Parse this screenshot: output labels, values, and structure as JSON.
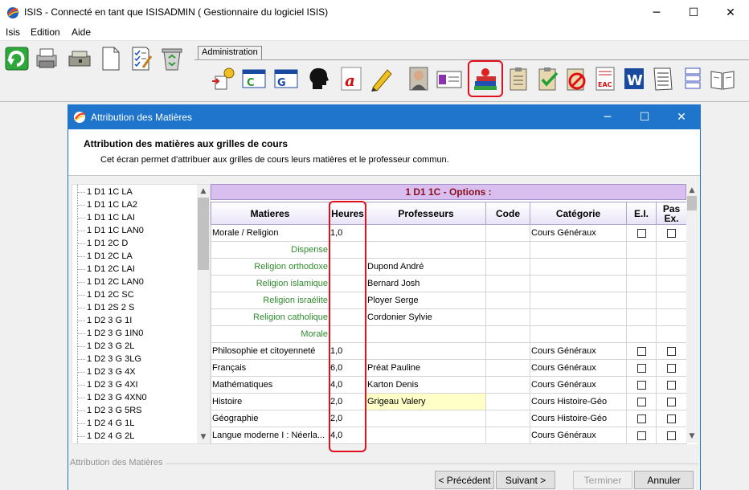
{
  "app": {
    "title": "ISIS - Connecté en tant que ISISADMIN ( Gestionnaire du logiciel ISIS)",
    "window_controls": {
      "minimize": "─",
      "maximize": "☐",
      "close": "✕"
    }
  },
  "menu": {
    "items": [
      "Isis",
      "Edition",
      "Aide"
    ]
  },
  "toolbar": {
    "tab_label": "Administration",
    "left_icons": [
      "refresh-icon",
      "printer-icon",
      "scanner-icon",
      "blank-page-icon",
      "checklist-icon",
      "recycle-bin-icon"
    ],
    "right_icons": [
      "import-settings-icon",
      "window-c-icon",
      "window-g-icon",
      "head-silhouette-icon",
      "letter-a-icon",
      "pencil-icon",
      "photo-person-icon",
      "id-card-icon",
      "books-apple-icon",
      "clipboard-notes-icon",
      "clipboard-check-icon",
      "clipboard-forbidden-icon",
      "eac-document-icon",
      "word-document-icon",
      "checklist-document-icon",
      "layout-rows-icon",
      "open-book-icon"
    ]
  },
  "dialog": {
    "title": "Attribution des Matières",
    "heading": "Attribution des matières aux grilles de cours",
    "description": "Cet écran permet d'attribuer aux grilles de cours leurs matières et le professeur commun.",
    "footer_label": "Attribution des Matières",
    "buttons": {
      "previous": "< Précédent",
      "next": "Suivant >",
      "finish": "Terminer",
      "cancel": "Annuler"
    }
  },
  "tree": {
    "items": [
      "1 D1 1C LA",
      "1 D1 1C LA2",
      "1 D1 1C LAI",
      "1 D1 1C LAN0",
      "1 D1 2C D",
      "1 D1 2C LA",
      "1 D1 2C LAI",
      "1 D1 2C LAN0",
      "1 D1 2C SC",
      "1 D1 2S 2 S",
      "1 D2 3 G 1I",
      "1 D2 3 G 1IN0",
      "1 D2 3 G 2L",
      "1 D2 3 G 3LG",
      "1 D2 3 G 4X",
      "1 D2 3 G 4XI",
      "1 D2 3 G 4XN0",
      "1 D2 3 G 5RS",
      "1 D2 4 G 1L",
      "1 D2 4 G 2L"
    ]
  },
  "grid": {
    "caption": "1 D1 1C  -  Options :",
    "columns": {
      "matieres": "Matieres",
      "heures": "Heures",
      "professeurs": "Professeurs",
      "code": "Code",
      "categorie": "Catégorie",
      "ei": "E.I.",
      "pas_ex": "Pas Ex."
    },
    "rows": [
      {
        "matiere": "Morale / Religion",
        "heures": "1,0",
        "professeur": "",
        "code": "",
        "categorie": "Cours Généraux",
        "checkboxes": true,
        "sub": false
      },
      {
        "matiere": "Dispense",
        "heures": "",
        "professeur": "",
        "code": "",
        "categorie": "",
        "checkboxes": false,
        "sub": true
      },
      {
        "matiere": "Religion orthodoxe",
        "heures": "",
        "professeur": "Dupond André",
        "code": "",
        "categorie": "",
        "checkboxes": false,
        "sub": true
      },
      {
        "matiere": "Religion islamique",
        "heures": "",
        "professeur": "Bernard Josh",
        "code": "",
        "categorie": "",
        "checkboxes": false,
        "sub": true
      },
      {
        "matiere": "Religion israélite",
        "heures": "",
        "professeur": "Ployer Serge",
        "code": "",
        "categorie": "",
        "checkboxes": false,
        "sub": true
      },
      {
        "matiere": "Religion catholique",
        "heures": "",
        "professeur": "Cordonier Sylvie",
        "code": "",
        "categorie": "",
        "checkboxes": false,
        "sub": true
      },
      {
        "matiere": "Morale",
        "heures": "",
        "professeur": "",
        "code": "",
        "categorie": "",
        "checkboxes": false,
        "sub": true
      },
      {
        "matiere": "Philosophie et citoyenneté",
        "heures": "1,0",
        "professeur": "",
        "code": "",
        "categorie": "Cours Généraux",
        "checkboxes": true,
        "sub": false
      },
      {
        "matiere": "Français",
        "heures": "6,0",
        "professeur": "Préat Pauline",
        "code": "",
        "categorie": "Cours Généraux",
        "checkboxes": true,
        "sub": false
      },
      {
        "matiere": "Mathématiques",
        "heures": "4,0",
        "professeur": "Karton Denis",
        "code": "",
        "categorie": "Cours Généraux",
        "checkboxes": true,
        "sub": false
      },
      {
        "matiere": "Histoire",
        "heures": "2,0",
        "professeur": "Grigeau Valery",
        "code": "",
        "categorie": "Cours Histoire-Géo",
        "checkboxes": true,
        "sub": false,
        "selected": true
      },
      {
        "matiere": "Géographie",
        "heures": "2,0",
        "professeur": "",
        "code": "",
        "categorie": "Cours Histoire-Géo",
        "checkboxes": true,
        "sub": false
      },
      {
        "matiere": "Langue moderne I : Néerla...",
        "heures": "4,0",
        "professeur": "",
        "code": "",
        "categorie": "Cours Généraux",
        "checkboxes": true,
        "sub": false
      }
    ]
  },
  "colors": {
    "dialog_title_bg": "#1f75cc",
    "caption_bg": "#d8bff0",
    "caption_text": "#8a1020",
    "sub_item_text": "#2e8b2e",
    "highlight": "#e0101e"
  }
}
